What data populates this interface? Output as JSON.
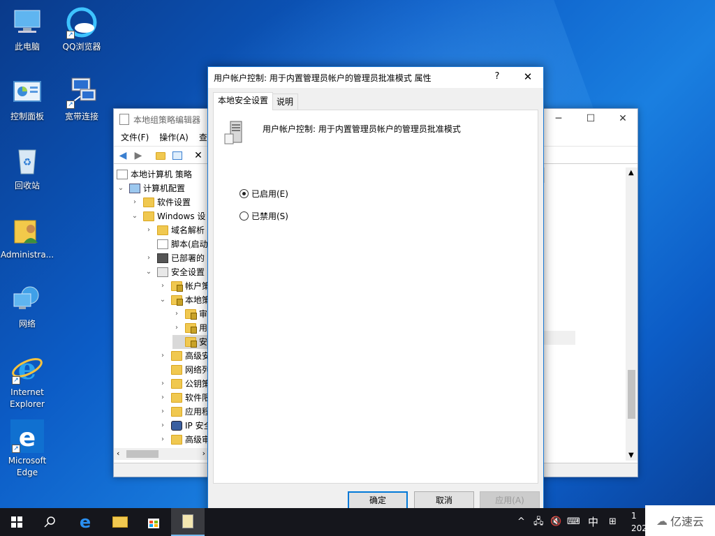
{
  "desktop": {
    "icons": [
      {
        "label": "此电脑"
      },
      {
        "label": "QQ浏览器"
      },
      {
        "label": "控制面板"
      },
      {
        "label": "宽带连接"
      },
      {
        "label": "回收站"
      },
      {
        "label": "Administra..."
      },
      {
        "label": "网络"
      },
      {
        "label": "Internet Explorer"
      },
      {
        "label": "Microsoft Edge"
      }
    ]
  },
  "gpedit": {
    "title": "本地组策略编辑器",
    "menu": [
      "文件(F)",
      "操作(A)",
      "查"
    ],
    "tree": [
      {
        "label": "本地计算机 策略"
      },
      {
        "label": "计算机配置"
      },
      {
        "label": "软件设置"
      },
      {
        "label": "Windows 设"
      },
      {
        "label": "域名解析"
      },
      {
        "label": "脚本(启动"
      },
      {
        "label": "已部署的"
      },
      {
        "label": "安全设置"
      },
      {
        "label": "帐户策"
      },
      {
        "label": "本地策"
      },
      {
        "label": "审"
      },
      {
        "label": "用"
      },
      {
        "label": "安"
      },
      {
        "label": "高级安"
      },
      {
        "label": "网络列"
      },
      {
        "label": "公钥策"
      },
      {
        "label": "软件限"
      },
      {
        "label": "应用程"
      },
      {
        "label": "IP 安全"
      },
      {
        "label": "高级审"
      }
    ]
  },
  "dialog": {
    "title": "用户帐户控制: 用于内置管理员帐户的管理员批准模式 属性",
    "help": "?",
    "close": "✕",
    "tabs": [
      "本地安全设置",
      "说明"
    ],
    "policy_name": "用户帐户控制: 用于内置管理员帐户的管理员批准模式",
    "options": [
      {
        "label": "已启用(E)",
        "checked": true
      },
      {
        "label": "已禁用(S)",
        "checked": false
      }
    ],
    "buttons": {
      "ok": "确定",
      "cancel": "取消",
      "apply": "应用(A)"
    }
  },
  "taskbar": {
    "ime": "中",
    "clock_top": "1",
    "clock_bottom": "202"
  },
  "watermark": "亿速云"
}
